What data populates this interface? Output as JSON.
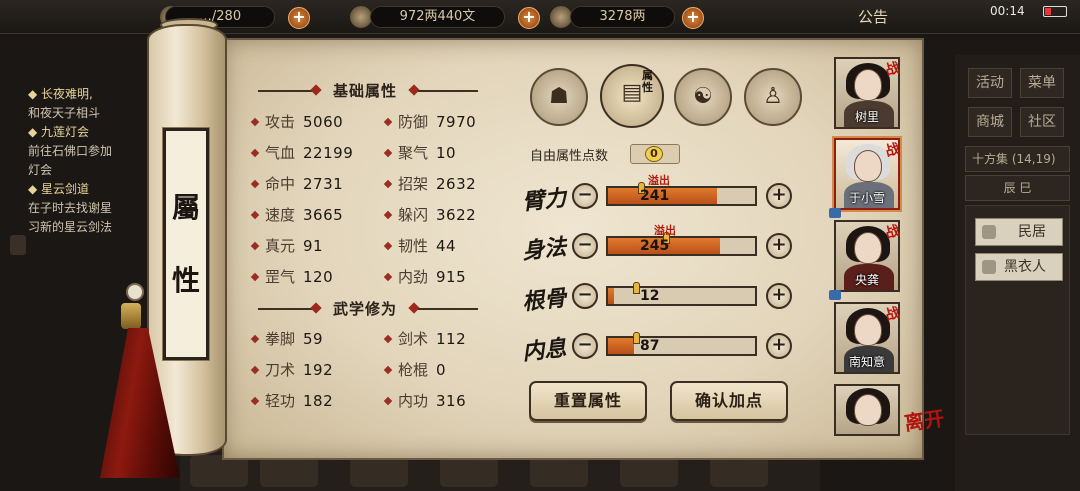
{
  "top_bar": {
    "bag_count": "…/280",
    "silver": "972两440文",
    "gold": "3278两",
    "notice": "公告",
    "time": "00:14"
  },
  "left_log": {
    "lines": [
      {
        "text": "◆ 长夜难明,",
        "quest": true
      },
      {
        "text": "和夜天子相斗",
        "quest": false
      },
      {
        "text": "◆ 九莲灯会",
        "quest": true
      },
      {
        "text": "前往石佛口参加",
        "quest": false
      },
      {
        "text": "灯会",
        "quest": false
      },
      {
        "text": "◆ 星云剑道",
        "quest": true
      },
      {
        "text": "在子时去找谢星",
        "quest": false
      },
      {
        "text": "习新的星云剑法",
        "quest": false
      }
    ]
  },
  "right_menu": {
    "buttons": [
      "活动",
      "菜单",
      "商城",
      "社区"
    ],
    "location": "十方集",
    "coords": "(14,19)",
    "time_period": "辰 巳",
    "npcs": [
      "民居",
      "黑衣人"
    ]
  },
  "scroll": {
    "title_chars": [
      "屬",
      "性"
    ]
  },
  "basic_attributes": {
    "title": "基础属性",
    "stats": [
      {
        "name": "攻击",
        "value": "5060"
      },
      {
        "name": "防御",
        "value": "7970"
      },
      {
        "name": "气血",
        "value": "22199"
      },
      {
        "name": "聚气",
        "value": "10"
      },
      {
        "name": "命中",
        "value": "2731"
      },
      {
        "name": "招架",
        "value": "2632"
      },
      {
        "name": "速度",
        "value": "3665"
      },
      {
        "name": "躲闪",
        "value": "3622"
      },
      {
        "name": "真元",
        "value": "91"
      },
      {
        "name": "韧性",
        "value": "44"
      },
      {
        "name": "罡气",
        "value": "120"
      },
      {
        "name": "内劲",
        "value": "915"
      }
    ]
  },
  "martial_training": {
    "title": "武学修为",
    "stats": [
      {
        "name": "拳脚",
        "value": "59"
      },
      {
        "name": "剑术",
        "value": "112"
      },
      {
        "name": "刀术",
        "value": "192"
      },
      {
        "name": "枪棍",
        "value": "0"
      },
      {
        "name": "轻功",
        "value": "182"
      },
      {
        "name": "内功",
        "value": "316"
      }
    ]
  },
  "tabs": {
    "active_label": "属性",
    "icons": [
      "character-hat-icon",
      "attribute-book-icon",
      "bagua-icon",
      "meridian-body-icon"
    ]
  },
  "allocation": {
    "free_points_label": "自由属性点数",
    "free_points": "0",
    "overflow_label": "溢出",
    "rows": [
      {
        "label": "臂力",
        "value": "241",
        "overflow": true,
        "fill": 0.74
      },
      {
        "label": "身法",
        "value": "245",
        "overflow": true,
        "fill": 0.76
      },
      {
        "label": "根骨",
        "value": "12",
        "overflow": false,
        "fill": 0.04
      },
      {
        "label": "内息",
        "value": "87",
        "overflow": false,
        "fill": 0.18
      }
    ],
    "reset_label": "重置属性",
    "confirm_label": "确认加点"
  },
  "party": {
    "members": [
      {
        "name": "树里",
        "active": false
      },
      {
        "name": "于小雪",
        "active": true
      },
      {
        "name": "央龚",
        "active": false
      },
      {
        "name": "南知意",
        "active": false
      },
      {
        "name": "",
        "active": false
      }
    ],
    "battle_mark": "战",
    "leave_label": "离开"
  },
  "colors": {
    "accent_red": "#9a2e22",
    "bar_fill": "#e07a2c",
    "paper": "#e8dcc3"
  }
}
